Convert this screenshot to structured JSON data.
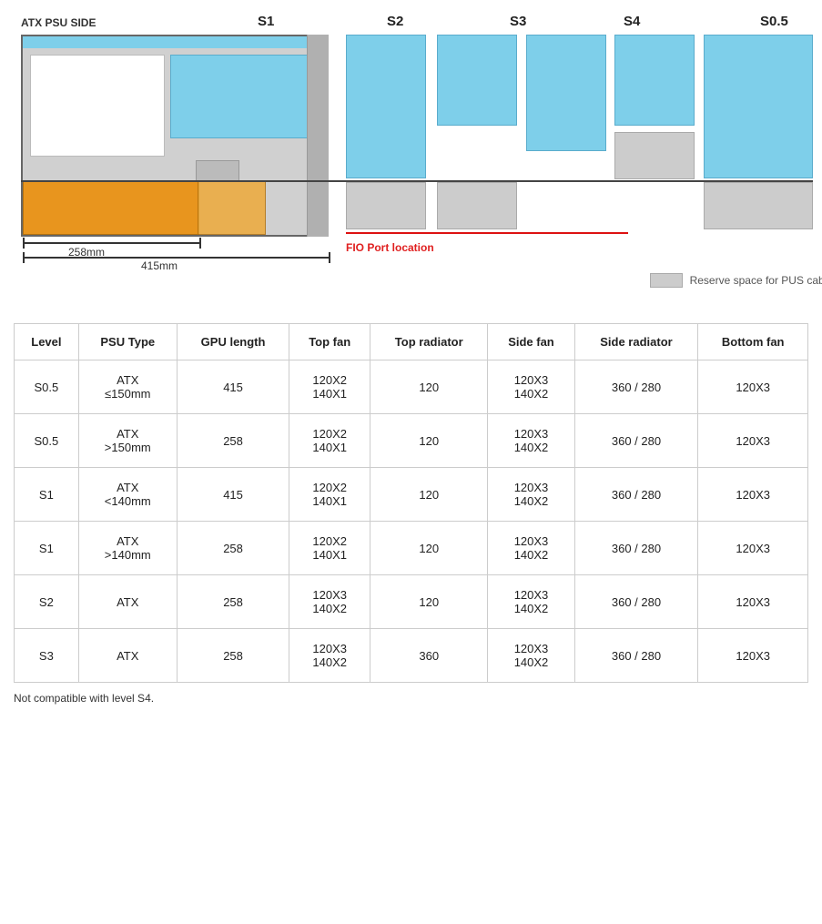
{
  "diagram": {
    "labels": {
      "atx_psu_side": "ATX PSU SIDE",
      "s1": "S1",
      "s2": "S2",
      "s3": "S3",
      "s4": "S4",
      "s05": "S0.5"
    },
    "measurements": {
      "m258": "258mm",
      "m415": "415mm"
    },
    "fio_label": "FIO Port location",
    "legend_label": "Reserve space for PUS cable"
  },
  "table": {
    "headers": [
      "Level",
      "PSU Type",
      "GPU length",
      "Top fan",
      "Top radiator",
      "Side fan",
      "Side radiator",
      "Bottom fan"
    ],
    "rows": [
      [
        "S0.5",
        "ATX\n≤150mm",
        "415",
        "120X2\n140X1",
        "120",
        "120X3\n140X2",
        "360 / 280",
        "120X3"
      ],
      [
        "S0.5",
        "ATX\n>150mm",
        "258",
        "120X2\n140X1",
        "120",
        "120X3\n140X2",
        "360 / 280",
        "120X3"
      ],
      [
        "S1",
        "ATX\n<140mm",
        "415",
        "120X2\n140X1",
        "120",
        "120X3\n140X2",
        "360 / 280",
        "120X3"
      ],
      [
        "S1",
        "ATX\n>140mm",
        "258",
        "120X2\n140X1",
        "120",
        "120X3\n140X2",
        "360 / 280",
        "120X3"
      ],
      [
        "S2",
        "ATX",
        "258",
        "120X3\n140X2",
        "120",
        "120X3\n140X2",
        "360 / 280",
        "120X3"
      ],
      [
        "S3",
        "ATX",
        "258",
        "120X3\n140X2",
        "360",
        "120X3\n140X2",
        "360 / 280",
        "120X3"
      ]
    ],
    "footnote": "Not compatible with level S4."
  }
}
